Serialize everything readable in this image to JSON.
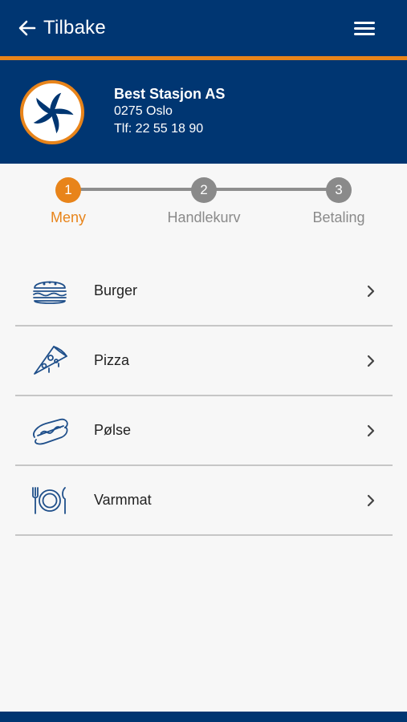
{
  "topbar": {
    "back_label": "Tilbake",
    "back_icon": "arrow-left-icon",
    "menu_icon": "hamburger-menu-icon"
  },
  "station": {
    "name": "Best Stasjon AS",
    "address": "0275 Oslo",
    "phone": "Tlf: 22 55 18 90",
    "logo_icon": "pinwheel-logo-icon"
  },
  "stepper": {
    "steps": [
      {
        "number": "1",
        "label": "Meny",
        "active": true
      },
      {
        "number": "2",
        "label": "Handlekurv",
        "active": false
      },
      {
        "number": "3",
        "label": "Betaling",
        "active": false
      }
    ]
  },
  "menu": {
    "items": [
      {
        "label": "Burger",
        "icon": "burger-icon"
      },
      {
        "label": "Pizza",
        "icon": "pizza-slice-icon"
      },
      {
        "label": "Pølse",
        "icon": "hotdog-icon"
      },
      {
        "label": "Varmmat",
        "icon": "plate-cutlery-icon"
      }
    ],
    "chevron_icon": "chevron-right-icon"
  },
  "colors": {
    "brand_blue": "#003672",
    "accent_orange": "#e8841a",
    "inactive_gray": "#8a8a8a",
    "icon_blue": "#1f4f8a"
  }
}
